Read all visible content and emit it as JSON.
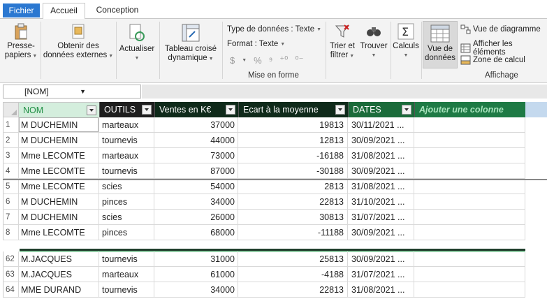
{
  "tabs": {
    "file": "Fichier",
    "home": "Accueil",
    "design": "Conception"
  },
  "ribbon": {
    "paste": {
      "line1": "Presse-",
      "line2": "papiers"
    },
    "external": {
      "line1": "Obtenir des",
      "line2": "données externes"
    },
    "refresh": "Actualiser",
    "pivot": {
      "line1": "Tableau croisé",
      "line2": "dynamique"
    },
    "datatype": "Type de données : Texte",
    "format": "Format : Texte",
    "format_symbols": {
      "currency": "$",
      "percent": "%",
      "thousands": "⁹",
      "inc": "⁺⁰",
      "dec": "⁰⁻"
    },
    "format_group_title": "Mise en forme",
    "sort": {
      "line1": "Trier et",
      "line2": "filtrer"
    },
    "find": "Trouver",
    "calc": "Calculs",
    "dataview": {
      "line1": "Vue de",
      "line2": "données"
    },
    "diagram_view": "Vue de diagramme",
    "show_hidden": "Afficher les éléments",
    "calc_area": "Zone de calcul",
    "view_group_title": "Affichage"
  },
  "namebox": {
    "value": "[NOM]"
  },
  "columns": {
    "nom": "NOM",
    "outils": "OUTILS",
    "ventes": "Ventes en K€",
    "ecart": "Ecart à la moyenne",
    "dates": "DATES",
    "add": "Ajouter une colonne"
  },
  "rows_top": [
    {
      "n": "1",
      "nom": "M DUCHEMIN",
      "outils": "marteaux",
      "ventes": "37000",
      "ecart": "19813",
      "date": "30/11/2021 ..."
    },
    {
      "n": "2",
      "nom": "M DUCHEMIN",
      "outils": "tournevis",
      "ventes": "44000",
      "ecart": "12813",
      "date": "30/09/2021 ..."
    },
    {
      "n": "3",
      "nom": "Mme LECOMTE",
      "outils": "marteaux",
      "ventes": "73000",
      "ecart": "-16188",
      "date": "31/08/2021 ..."
    },
    {
      "n": "4",
      "nom": "Mme LECOMTE",
      "outils": "tournevis",
      "ventes": "87000",
      "ecart": "-30188",
      "date": "30/09/2021 ..."
    },
    {
      "n": "5",
      "nom": "Mme LECOMTE",
      "outils": "scies",
      "ventes": "54000",
      "ecart": "2813",
      "date": "31/08/2021 ..."
    },
    {
      "n": "6",
      "nom": "M DUCHEMIN",
      "outils": "pinces",
      "ventes": "34000",
      "ecart": "22813",
      "date": "31/10/2021 ..."
    },
    {
      "n": "7",
      "nom": "M DUCHEMIN",
      "outils": "scies",
      "ventes": "26000",
      "ecart": "30813",
      "date": "31/07/2021 ..."
    },
    {
      "n": "8",
      "nom": "Mme LECOMTE",
      "outils": "pinces",
      "ventes": "68000",
      "ecart": "-11188",
      "date": "30/09/2021 ..."
    }
  ],
  "rows_bottom": [
    {
      "n": "62",
      "nom": "M.JACQUES",
      "outils": "tournevis",
      "ventes": "31000",
      "ecart": "25813",
      "date": "30/09/2021 ..."
    },
    {
      "n": "63",
      "nom": "M.JACQUES",
      "outils": "marteaux",
      "ventes": "61000",
      "ecart": "-4188",
      "date": "31/07/2021 ..."
    },
    {
      "n": "64",
      "nom": "MME DURAND",
      "outils": "tournevis",
      "ventes": "34000",
      "ecart": "22813",
      "date": "31/08/2021 ..."
    }
  ],
  "colors": {
    "file_tab": "#2b78d1",
    "accent_green": "#1e7a45",
    "header_dark": "#0f2a1a"
  }
}
